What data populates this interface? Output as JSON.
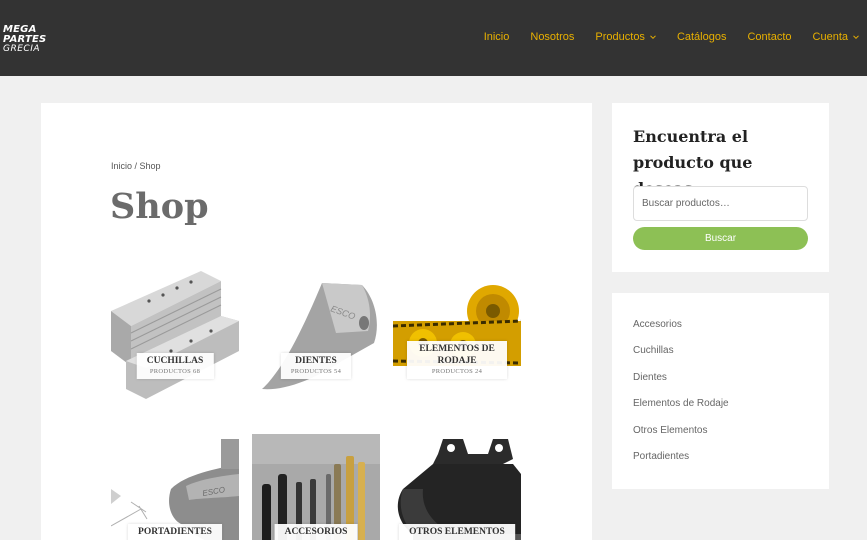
{
  "header": {
    "logo": {
      "line1": "MEGA",
      "line2": "PARTES",
      "line3": "GRECIA"
    },
    "nav": [
      {
        "label": "Inicio",
        "has_dropdown": false
      },
      {
        "label": "Nosotros",
        "has_dropdown": false
      },
      {
        "label": "Productos",
        "has_dropdown": true
      },
      {
        "label": "Catálogos",
        "has_dropdown": false
      },
      {
        "label": "Contacto",
        "has_dropdown": false
      },
      {
        "label": "Cuenta",
        "has_dropdown": true
      }
    ]
  },
  "main": {
    "breadcrumb": {
      "home": "Inicio",
      "separator": " / ",
      "current": "Shop"
    },
    "title": "Shop",
    "categories": [
      {
        "name": "CUCHILLAS",
        "count": "PRODUCTOS 68"
      },
      {
        "name": "DIENTES",
        "count": "PRODUCTOS 54"
      },
      {
        "name": "ELEMENTOS DE RODAJE",
        "count": "PRODUCTOS 24"
      },
      {
        "name": "PORTADIENTES",
        "count": ""
      },
      {
        "name": "ACCESORIOS",
        "count": ""
      },
      {
        "name": "OTROS ELEMENTOS",
        "count": ""
      }
    ]
  },
  "sidebar": {
    "search_heading": "Encuentra el producto que deseas",
    "search_placeholder": "Buscar productos…",
    "search_button": "Buscar",
    "category_links": [
      "Accesorios",
      "Cuchillas",
      "Dientes",
      "Elementos de Rodaje",
      "Otros Elementos",
      "Portadientes"
    ]
  },
  "colors": {
    "header_bg": "#333333",
    "nav_link": "#e8b000",
    "button": "#8dc055",
    "page_bg": "#f0f0f0"
  }
}
